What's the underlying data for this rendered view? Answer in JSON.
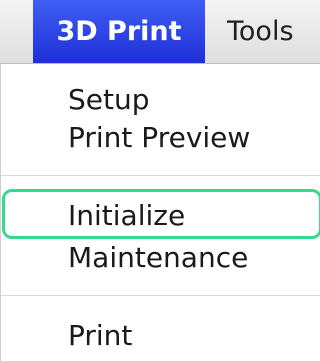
{
  "menubar": {
    "active_menu": "3D Print",
    "next_menu": "Tools"
  },
  "dropdown": {
    "items": [
      {
        "label": "Setup"
      },
      {
        "label": "Print Preview"
      },
      {
        "label": "Initialize"
      },
      {
        "label": "Maintenance"
      },
      {
        "label": "Print"
      }
    ]
  },
  "colors": {
    "active_menu_bg": "#2a3de6",
    "highlight_outline": "#37d98b"
  }
}
